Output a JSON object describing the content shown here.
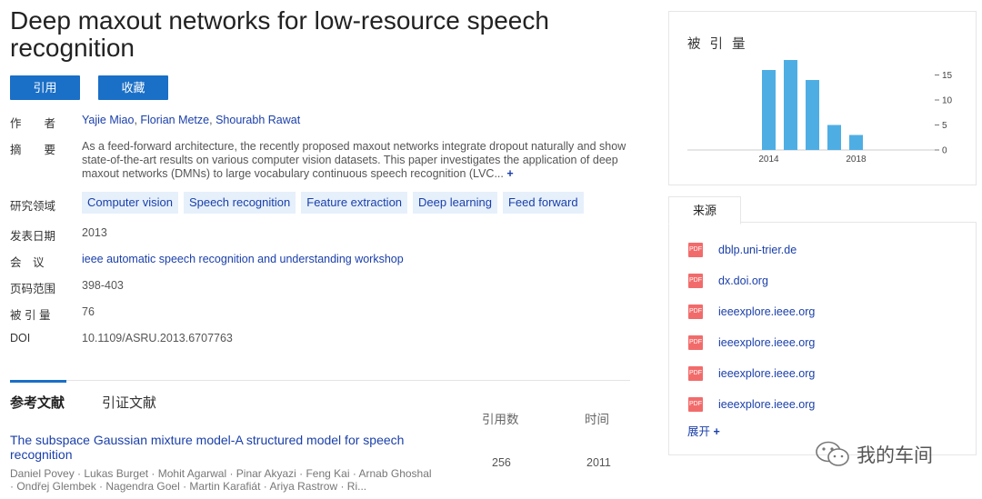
{
  "title": "Deep maxout networks for low-resource speech recognition",
  "buttons": {
    "cite": "引用",
    "favorite": "收藏"
  },
  "meta": {
    "authors_label": "作　　者",
    "authors": [
      "Yajie Miao",
      "Florian Metze",
      "Shourabh Rawat"
    ],
    "abstract_label": "摘　　要",
    "abstract": "As a feed-forward architecture, the recently proposed maxout networks integrate dropout naturally and show state-of-the-art results on various computer vision datasets. This paper investigates the application of deep maxout networks (DMNs) to large vocabulary continuous speech recognition (LVC...",
    "abstract_more": "+",
    "fields_label": "研究领域",
    "fields": [
      "Computer vision",
      "Speech recognition",
      "Feature extraction",
      "Deep learning",
      "Feed forward"
    ],
    "date_label": "发表日期",
    "date": "2013",
    "venue_label": "会　议",
    "venue": "ieee automatic speech recognition and understanding workshop",
    "pages_label": "页码范围",
    "pages": "398-403",
    "cited_label": "被 引 量",
    "cited": "76",
    "doi_label": "DOI",
    "doi": "10.1109/ASRU.2013.6707763"
  },
  "tabs": {
    "active": "参考文献",
    "other": "引证文献"
  },
  "table_headers": {
    "citations": "引用数",
    "year": "时间"
  },
  "references": [
    {
      "title": "The subspace Gaussian mixture model-A structured model for speech recognition",
      "authors": "Daniel Povey · Lukas Burget · Mohit Agarwal · Pinar Akyazi · Feng Kai · Arnab Ghoshal · Ondřej Glembek · Nagendra Goel · Martin Karafiát · Ariya Rastrow · Ri...",
      "citations": "256",
      "year": "2011"
    }
  ],
  "cited_panel": {
    "title": "被 引 量"
  },
  "chart_data": {
    "type": "bar",
    "x": [
      2014,
      2015,
      2016,
      2017,
      2018
    ],
    "values": [
      16,
      18,
      14,
      5,
      3
    ],
    "xticks": [
      "2014",
      "2018"
    ],
    "yticks": [
      "0",
      "5",
      "10",
      "15"
    ],
    "ylim": [
      0,
      20
    ],
    "color": "#4eaee4",
    "axis_position": "right"
  },
  "sources": {
    "tab_label": "来源",
    "items": [
      {
        "icon": "pdf-icon",
        "label": "PDF",
        "text": "dblp.uni-trier.de"
      },
      {
        "icon": "pdf-icon",
        "label": "PDF",
        "text": "dx.doi.org"
      },
      {
        "icon": "pdf-icon",
        "label": "PDF",
        "text": "ieeexplore.ieee.org"
      },
      {
        "icon": "pdf-icon",
        "label": "PDF",
        "text": "ieeexplore.ieee.org"
      },
      {
        "icon": "pdf-icon",
        "label": "PDF",
        "text": "ieeexplore.ieee.org"
      },
      {
        "icon": "pdf-icon",
        "label": "PDF",
        "text": "ieeexplore.ieee.org"
      }
    ],
    "expand": "展开",
    "expand_icon": "+"
  },
  "watermark": {
    "icon": "wechat-icon",
    "text": "我的车间"
  }
}
